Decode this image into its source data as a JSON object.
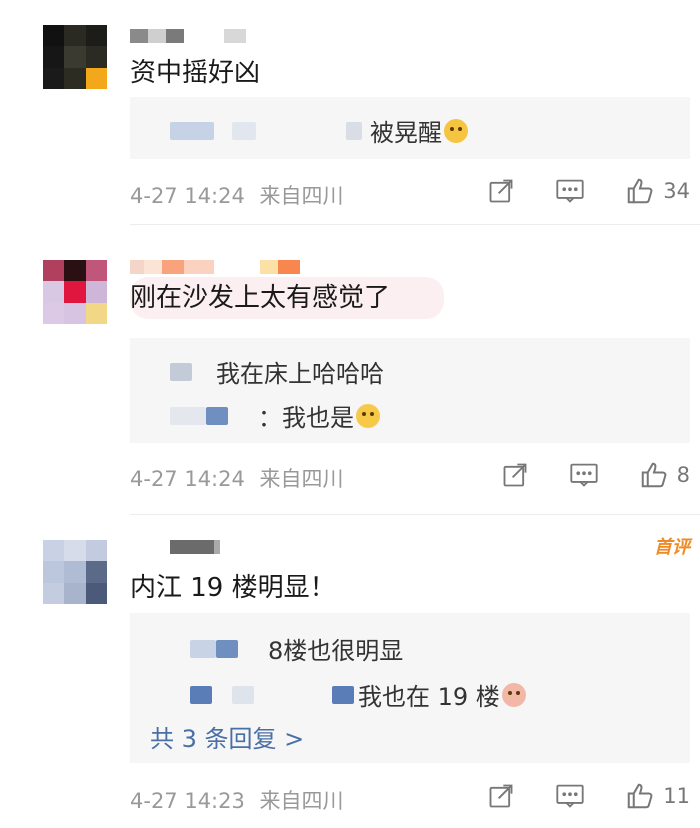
{
  "comments": [
    {
      "text": "资中摇好凶",
      "reply": {
        "text": "被晃醒",
        "emoji": "crying-face-emoji"
      },
      "date": "4-27 14:24",
      "source": "来自四川",
      "likes": "34"
    },
    {
      "text": "刚在沙发上太有感觉了",
      "replies": [
        {
          "text": "我在床上哈哈哈"
        },
        {
          "text": "：我也是",
          "emoji": "laughing-tears-emoji"
        }
      ],
      "date": "4-27 14:24",
      "source": "来自四川",
      "likes": "8"
    },
    {
      "badge": "首评",
      "text": "内江 19 楼明显！",
      "replies": [
        {
          "text": "8楼也很明显"
        },
        {
          "text": "我也在 19 楼",
          "emoji": "pig-face-emoji"
        }
      ],
      "more_replies": "共 3 条回复 >",
      "date": "4-27 14:23",
      "source": "来自四川",
      "likes": "11"
    }
  ],
  "icons": {
    "share": "share-icon",
    "comment": "comment-icon",
    "like": "thumbs-up-icon"
  },
  "colors": {
    "link": "#4a6fa5",
    "meta": "#999999",
    "badge": "#f08a24",
    "reply_bg": "#f6f6f6"
  }
}
